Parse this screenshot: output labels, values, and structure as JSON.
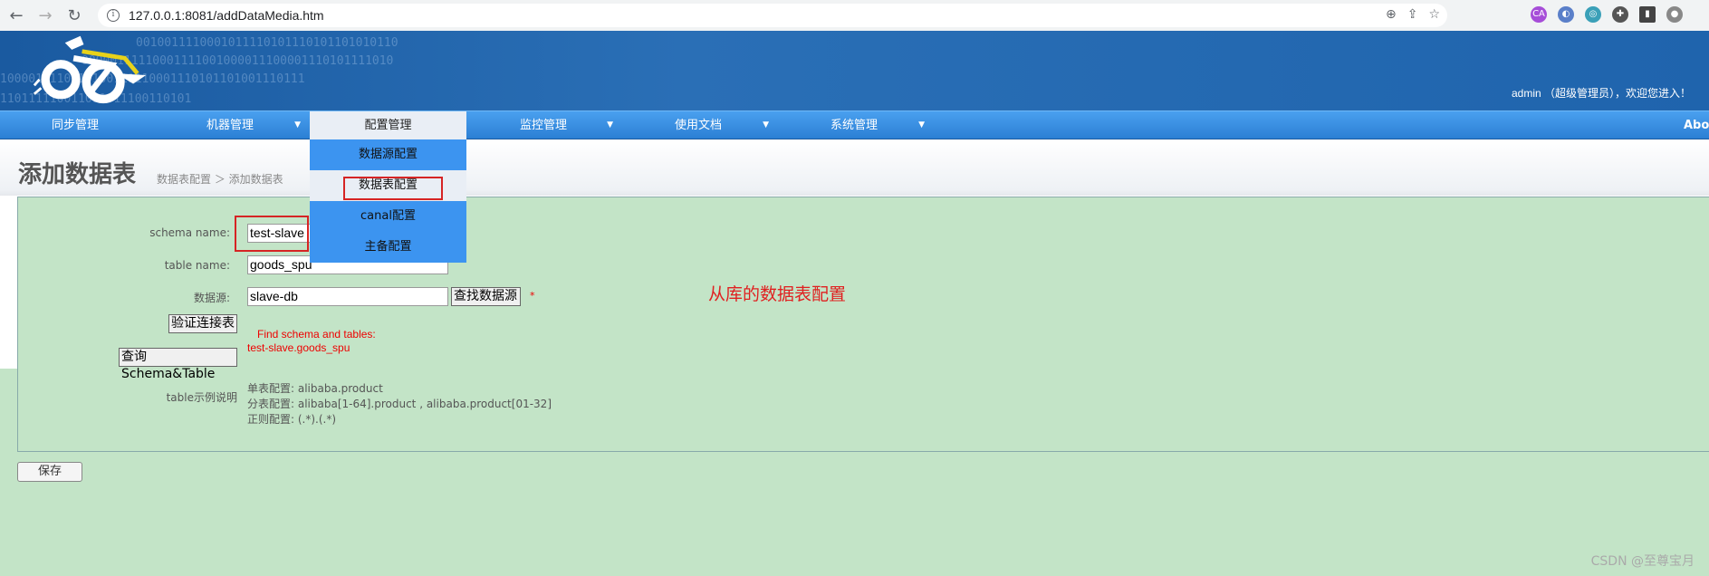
{
  "browser": {
    "url": "127.0.0.1:8081/addDataMedia.htm"
  },
  "header": {
    "welcome": "admin （超级管理员），欢迎您进入！",
    "binary_lines": [
      "0010011110001011110101110101101010110",
      "00000111110001111001000011100001110101111010",
      "1000011110010100111110001110101101001110111",
      "110111110011011011100110101"
    ]
  },
  "nav": {
    "items": [
      {
        "label": "同步管理",
        "arrow": false
      },
      {
        "label": "机器管理",
        "arrow": true
      },
      {
        "label": "配置管理",
        "arrow": true
      },
      {
        "label": "监控管理",
        "arrow": true
      },
      {
        "label": "使用文档",
        "arrow": true
      },
      {
        "label": "系统管理",
        "arrow": true
      }
    ],
    "about": "Abo",
    "arrow_glyph": "▼"
  },
  "dropdown": {
    "items": [
      "数据源配置",
      "数据表配置",
      "canal配置",
      "主备配置"
    ]
  },
  "page": {
    "title": "添加数据表",
    "breadcrumb": "数据表配置 ＞ 添加数据表"
  },
  "form": {
    "schema_label": "schema name:",
    "schema_value": "test-slave",
    "table_label": "table name:",
    "table_value": "goods_spu",
    "source_label": "数据源:",
    "source_value": "slave-db",
    "find_source_button": "查找数据源",
    "star": "*",
    "verify_button": "验证连接表",
    "query_button": "查询Schema&Table",
    "result_line1": "Find schema and tables:",
    "result_line2": "test-slave.goods_spu",
    "example_label": "table示例说明",
    "example_lines": [
      "单表配置: alibaba.product",
      "分表配置: alibaba[1-64].product , alibaba.product[01-32]",
      "正则配置: (.*).(.*)"
    ]
  },
  "annotation": "从库的数据表配置",
  "save_button": "保存",
  "watermark": "CSDN @至尊宝月",
  "colors": {
    "header_blue": "#1f64ad",
    "nav_blue": "#3c94f0",
    "panel_green": "#c3e4c7",
    "highlight_red": "#d62424"
  }
}
